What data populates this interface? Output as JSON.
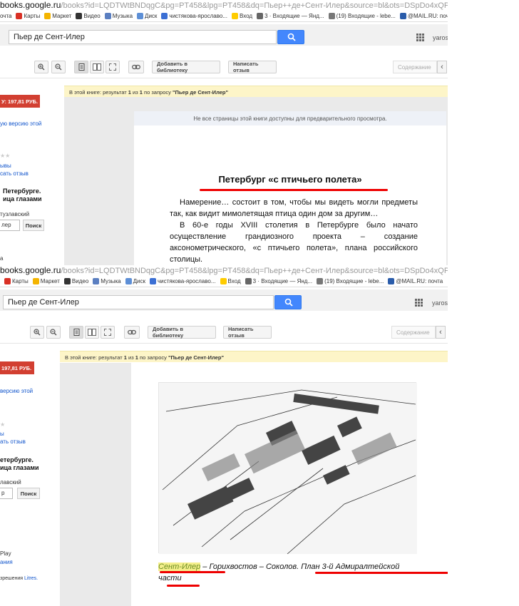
{
  "browser": {
    "url_host": "books.google.ru",
    "url_path_1": "/books?id=LQDTWtBNDqgC&pg=PT458&lpg=PT458&dq=Пьер++де+Сент-Илер&source=bl&ots=DSpDo4xQPV8&sig=",
    "url_path_2": "/books?id=LQDTWtBNDqgC&pg=PT458&lpg=PT458&dq=Пьер++де+Сент-Илер&source=bl&ots=DSpDo4xQPV8&sig=",
    "bookmarks_1": [
      {
        "label": "очта",
        "color": "#ffffff"
      },
      {
        "label": "Карты",
        "color": "#d93025"
      },
      {
        "label": "Маркет",
        "color": "#f4b400"
      },
      {
        "label": "Видео",
        "color": "#333333"
      },
      {
        "label": "Музыка",
        "color": "#5b7fc1"
      },
      {
        "label": "Диск",
        "color": "#5d8fd6"
      },
      {
        "label": "чистякова-ярославо...",
        "color": "#3b6fd4"
      },
      {
        "label": "Вход",
        "color": "#ffcc00"
      },
      {
        "label": "3 · Входящие — Янд...",
        "color": "#666666"
      },
      {
        "label": "(19) Входящие - lebe...",
        "color": "#777777"
      },
      {
        "label": "@MAIL.RU: почта",
        "color": "#2a5caa"
      }
    ],
    "bookmarks_2": [
      {
        "label": "",
        "color": "#ffcc00"
      },
      {
        "label": "Карты",
        "color": "#d93025"
      },
      {
        "label": "Маркет",
        "color": "#f4b400"
      },
      {
        "label": "Видео",
        "color": "#333333"
      },
      {
        "label": "Музыка",
        "color": "#5b7fc1"
      },
      {
        "label": "Диск",
        "color": "#5d8fd6"
      },
      {
        "label": "чистякова-ярославо...",
        "color": "#3b6fd4"
      },
      {
        "label": "Вход",
        "color": "#ffcc00"
      },
      {
        "label": "3 · Входящие — Янд...",
        "color": "#666666"
      },
      {
        "label": "(19) Входящие - lebe...",
        "color": "#777777"
      },
      {
        "label": "@MAIL.RU: почта",
        "color": "#2a5caa"
      }
    ]
  },
  "search": {
    "query": "Пьер де Сент-Илер",
    "user": "yaros"
  },
  "toolbar": {
    "add_to_library": "Добавить в библиотеку",
    "write_review": "Написать отзыв",
    "contents": "Содержание"
  },
  "sidebar_1": {
    "buy_button": "У: 197,81 РУБ.",
    "ebook_link": "ую версию этой",
    "reviews_link": "ывы",
    "write_review_link": "сать отзыв",
    "title_line1": "Петербурге.",
    "title_line2": "ица глазами",
    "author": "тузлавский",
    "search_input": "лер",
    "search_button": "Поиск",
    "a_letter": "а"
  },
  "sidebar_2": {
    "buy_button": "197,81 РУБ.",
    "ebook_link": "версию этой",
    "reviews_link": "ы",
    "write_review_link": "ать отзыв",
    "title_line1": "етербурге.",
    "title_line2": "ица глазами",
    "author": "лавский",
    "search_input": "р",
    "search_button": "Поиск",
    "play_line1": "Play",
    "play_line2": "ания",
    "litres_prefix": "зрешения",
    "litres_link": "Litres."
  },
  "results_bar": {
    "prefix": "В этой книге: результат",
    "current": "1",
    "of": "из",
    "total": "1",
    "by_query": "по запросу",
    "query": "\"Пьер де Сент-Илер\""
  },
  "page1": {
    "notice": "Не все страницы этой книги доступны для предварительного просмотра.",
    "heading": "Петербург «с птичьего полета»",
    "paragraph1": "Намерение… состоит в том, чтобы мы видеть могли предметы так, как видит мимолетящая птица один дом за другим…",
    "paragraph2": "В 60-е годы XVIII столетия в Петербурге было начато осуществление грандиозного проекта – создание аксонометрического, «с птичьего полета», плана российского столицы."
  },
  "page2": {
    "caption_highlight": "Сент-Илер",
    "caption_rest": " – Горихвостов – Соколов. План 3-й Адмиралтейской",
    "caption_line2": "части"
  },
  "colors": {
    "accent_blue": "#4387fd",
    "buy_red": "#d23f31",
    "annotation_red": "#e00000",
    "info_yellow": "#fdf5c8"
  }
}
